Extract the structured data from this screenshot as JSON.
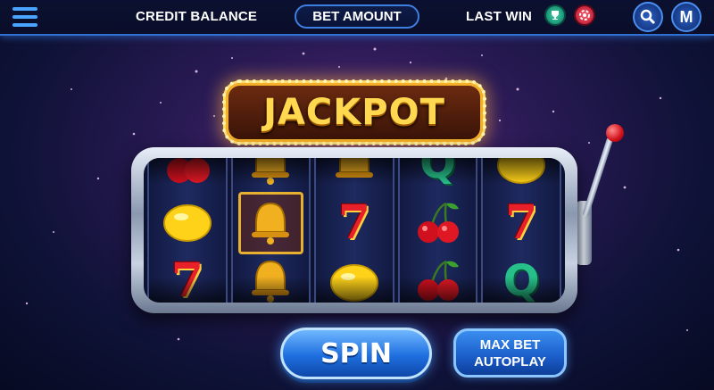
{
  "topbar": {
    "credit_label": "CREDIT BALANCE",
    "bet_label": "BET AMOUNT",
    "win_label": "LAST WIN",
    "icons": [
      "menu-icon",
      "trophy-icon",
      "chip-icon",
      "search-icon",
      "m-logo-icon"
    ],
    "m_letter": "M"
  },
  "sign": {
    "text": "JACKPOT"
  },
  "reels": [
    {
      "top": "cherry",
      "middle": "lemon",
      "bottom": "seven"
    },
    {
      "top": "bell",
      "middle": "bell",
      "bottom": "bell"
    },
    {
      "top": "bell",
      "middle": "seven",
      "bottom": "lemon"
    },
    {
      "top": "Q",
      "middle": "cherry",
      "bottom": "cherry"
    },
    {
      "top": "lemon",
      "middle": "seven",
      "bottom": "Q"
    }
  ],
  "symbols": {
    "seven": "7",
    "q": "Q"
  },
  "controls": {
    "spin_label": "SPIN",
    "max_bet_label": "MAX BET",
    "autoplay_label": "AUTOPLAY"
  },
  "colors": {
    "accent": "#2f6fd0",
    "gold": "#f5b02a",
    "seven_red": "#e8202a",
    "q_green": "#28c08a"
  }
}
